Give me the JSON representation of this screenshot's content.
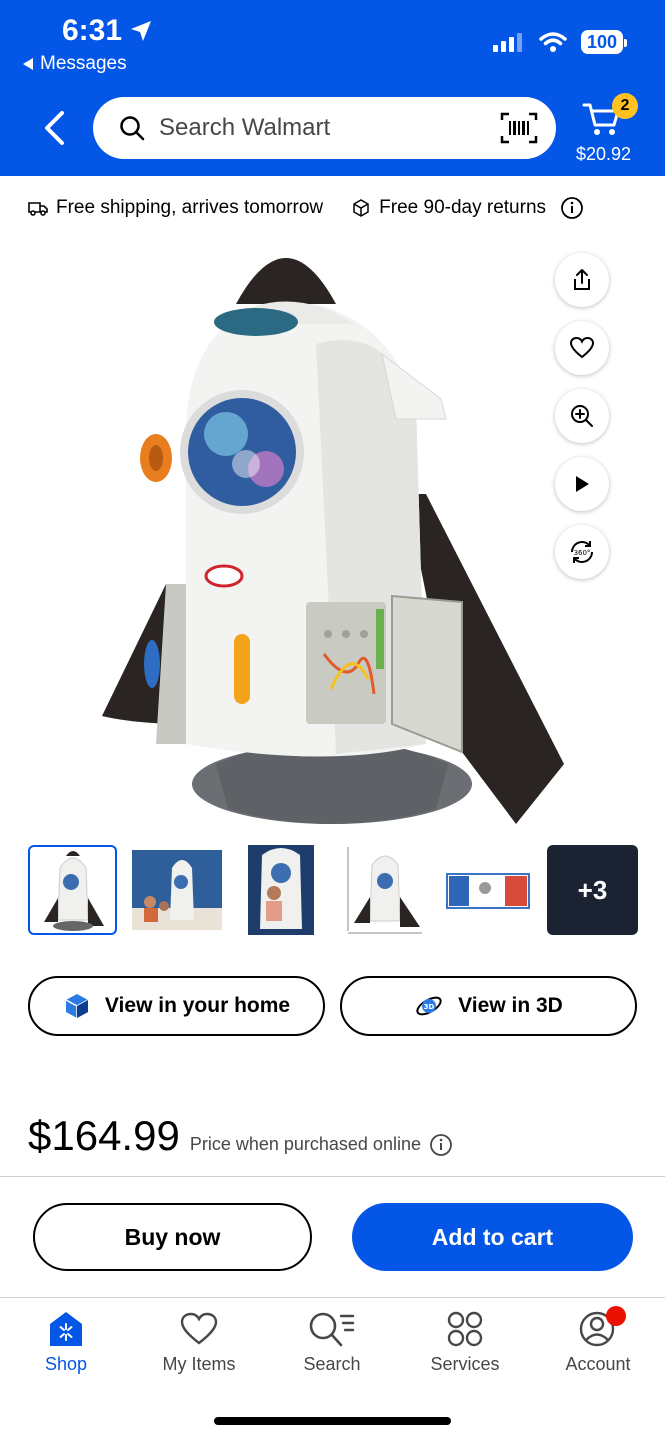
{
  "status_bar": {
    "time": "6:31",
    "back_app": "Messages",
    "battery": "100"
  },
  "header": {
    "search_placeholder": "Search Walmart",
    "cart_count": "2",
    "cart_total": "$20.92"
  },
  "shipping": {
    "shipping_text": "Free shipping, arrives tomorrow",
    "returns_text": "Free 90-day returns"
  },
  "thumbnails": {
    "more_label": "+3"
  },
  "view_buttons": {
    "home_label": "View in your home",
    "three_d_label": "View in 3D"
  },
  "price": {
    "amount": "$164.99",
    "note": "Price when purchased online"
  },
  "actions": {
    "buy_now": "Buy now",
    "add_to_cart": "Add to cart"
  },
  "bottom_nav": {
    "items": [
      {
        "label": "Shop",
        "icon": "shop-icon",
        "active": true
      },
      {
        "label": "My Items",
        "icon": "heart-icon"
      },
      {
        "label": "Search",
        "icon": "search-list-icon"
      },
      {
        "label": "Services",
        "icon": "grid-circles-icon"
      },
      {
        "label": "Account",
        "icon": "account-icon"
      }
    ]
  },
  "colors": {
    "brand_blue": "#0457e6",
    "badge_yellow": "#ffc220",
    "notification_red": "#ea1100"
  }
}
